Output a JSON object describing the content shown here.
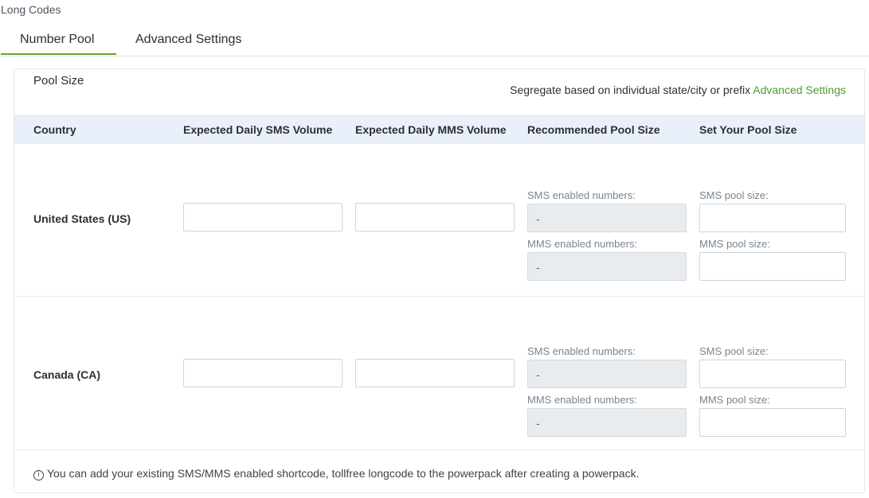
{
  "header": {
    "section_title": "Long Codes"
  },
  "tabs": [
    {
      "label": "Number Pool",
      "active": true
    },
    {
      "label": "Advanced Settings",
      "active": false
    }
  ],
  "pool": {
    "title": "Pool Size",
    "segregate_text": "Segregate based on individual state/city or prefix",
    "segregate_link": "Advanced Settings"
  },
  "table": {
    "columns": [
      "Country",
      "Expected Daily SMS Volume",
      "Expected Daily MMS Volume",
      "Recommended Pool Size",
      "Set Your Pool Size"
    ],
    "rows": [
      {
        "country": "United States (US)",
        "sms_volume": "",
        "mms_volume": "",
        "sms_enabled_label": "SMS enabled numbers:",
        "sms_enabled_value": "-",
        "mms_enabled_label": "MMS enabled numbers:",
        "mms_enabled_value": "-",
        "sms_pool_label": "SMS pool size:",
        "mms_pool_label": "MMS pool size:"
      },
      {
        "country": "Canada (CA)",
        "sms_volume": "",
        "mms_volume": "",
        "sms_enabled_label": "SMS enabled numbers:",
        "sms_enabled_value": "-",
        "mms_enabled_label": "MMS enabled numbers:",
        "mms_enabled_value": "-",
        "sms_pool_label": "SMS pool size:",
        "mms_pool_label": "MMS pool size:"
      }
    ]
  },
  "footnote": {
    "icon": "info-icon",
    "text": "You can add your existing SMS/MMS enabled shortcode, tollfree longcode to the powerpack after creating a powerpack."
  },
  "colors": {
    "accent": "#5aa832",
    "link": "#4e9c2e",
    "header_bg": "#eaf0fa",
    "readonly_bg": "#e9ecef"
  }
}
